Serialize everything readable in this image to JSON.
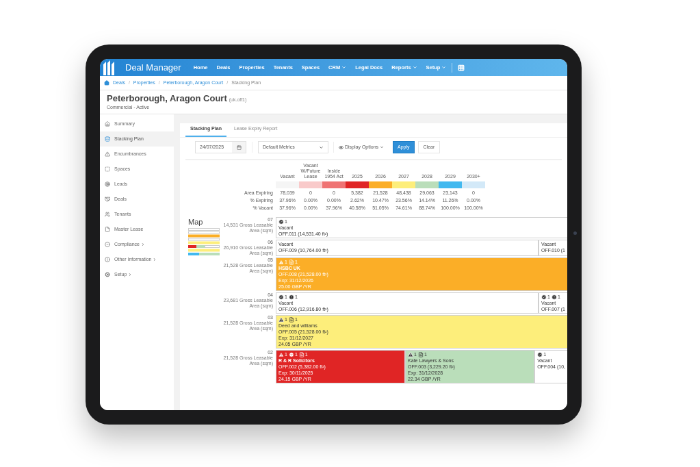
{
  "nav": {
    "brand": "Deal Manager",
    "items": [
      {
        "label": "Home",
        "dropdown": false
      },
      {
        "label": "Deals",
        "dropdown": false
      },
      {
        "label": "Properties",
        "dropdown": false
      },
      {
        "label": "Tenants",
        "dropdown": false
      },
      {
        "label": "Spaces",
        "dropdown": false
      },
      {
        "label": "CRM",
        "dropdown": true
      },
      {
        "label": "Legal Docs",
        "dropdown": false
      },
      {
        "label": "Reports",
        "dropdown": true
      },
      {
        "label": "Setup",
        "dropdown": true
      }
    ]
  },
  "breadcrumb": {
    "separator": "/",
    "items": [
      {
        "label": "Deals",
        "current": false
      },
      {
        "label": "Properties",
        "current": false
      },
      {
        "label": "Peterborough, Aragon Court",
        "current": false
      },
      {
        "label": "Stacking Plan",
        "current": true
      }
    ]
  },
  "header": {
    "title": "Peterborough, Aragon Court",
    "code": "(uk.off1)",
    "subtitle": "Commercial - Active"
  },
  "sidebar": [
    {
      "label": "Summary",
      "selected": false,
      "submenu": false
    },
    {
      "label": "Stacking Plan",
      "selected": true,
      "submenu": false
    },
    {
      "label": "Encumbrances",
      "selected": false,
      "submenu": false
    },
    {
      "label": "Spaces",
      "selected": false,
      "submenu": false
    },
    {
      "label": "Leads",
      "selected": false,
      "submenu": false
    },
    {
      "label": "Deals",
      "selected": false,
      "submenu": false
    },
    {
      "label": "Tenants",
      "selected": false,
      "submenu": false
    },
    {
      "label": "Master Lease",
      "selected": false,
      "submenu": false
    },
    {
      "label": "Compliance",
      "selected": false,
      "submenu": true
    },
    {
      "label": "Other Information",
      "selected": false,
      "submenu": true
    },
    {
      "label": "Setup",
      "selected": false,
      "submenu": true
    }
  ],
  "tabs": [
    {
      "label": "Stacking Plan",
      "selected": true
    },
    {
      "label": "Lease Expiry Report",
      "selected": false
    }
  ],
  "toolbar": {
    "date": "24/07/2025",
    "metrics": "Default Metrics",
    "display_options": "Display Options",
    "apply": "Apply",
    "clear": "Clear"
  },
  "metrics": {
    "columns": [
      {
        "label": "Vacant",
        "color": "#f5f5f5"
      },
      {
        "label": "Vacant W/Future Lease",
        "color": "#f9caca"
      },
      {
        "label": "Inside 1954 Act",
        "color": "#ef7373"
      },
      {
        "label": "2025",
        "color": "#e02525"
      },
      {
        "label": "2026",
        "color": "#fbae27"
      },
      {
        "label": "2027",
        "color": "#fdee7b"
      },
      {
        "label": "2028",
        "color": "#badeba"
      },
      {
        "label": "2029",
        "color": "#42b9ef"
      },
      {
        "label": "2030+",
        "color": "#d3e9f8"
      }
    ],
    "rows": [
      {
        "label": "Area Expiring",
        "values": [
          "78,039",
          "0",
          "0",
          "5,382",
          "21,528",
          "48,438",
          "29,063",
          "23,143",
          "0"
        ]
      },
      {
        "label": "% Expiring",
        "values": [
          "37.96%",
          "0.00%",
          "0.00%",
          "2.62%",
          "10.47%",
          "23.56%",
          "14.14%",
          "11.26%",
          "0.00%"
        ]
      },
      {
        "label": "% Vacant",
        "values": [
          "37.96%",
          "0.00%",
          "37.96%",
          "40.58%",
          "51.05%",
          "74.61%",
          "88.74%",
          "100.00%",
          "100.00%"
        ]
      }
    ]
  },
  "map_title": "Map",
  "floors": [
    {
      "number": "07",
      "area": "14,531 Gross Leasable Area (sqm)",
      "units": [
        {
          "color": "#ffffff",
          "badges": [
            {
              "kind": "check",
              "count": "1"
            }
          ],
          "lines": [
            "Vacant",
            "OFF.011 (14,531.40 ft²)"
          ]
        }
      ]
    },
    {
      "number": "06",
      "area": "26,910 Gross Leasable Area (sqm)",
      "units": [
        {
          "color": "#ffffff",
          "lines": [
            "Vacant",
            "OFF.009 (10,764.00 ft²)"
          ]
        },
        {
          "color": "#ffffff",
          "lines": [
            "Vacant",
            "OFF.010 (1"
          ]
        }
      ]
    },
    {
      "number": "05",
      "area": "21,528 Gross Leasable Area (sqm)",
      "units": [
        {
          "color": "#fbae27",
          "badges": [
            {
              "kind": "warning",
              "count": "1"
            },
            {
              "kind": "file",
              "count": "1"
            }
          ],
          "lines": [
            "HSBC UK",
            "OFF.008 (21,528.00 ft²)",
            "Exp: 31/12/2026",
            "25.00 GBP /YR"
          ]
        }
      ]
    },
    {
      "number": "04",
      "area": "23,681 Gross Leasable Area (sqm)",
      "units": [
        {
          "color": "#ffffff",
          "badges": [
            {
              "kind": "check",
              "count": "1"
            },
            {
              "kind": "info",
              "count": "1"
            }
          ],
          "lines": [
            "Vacant",
            "OFF.006 (12,916.80 ft²)"
          ]
        },
        {
          "color": "#ffffff",
          "badges": [
            {
              "kind": "check",
              "count": "1"
            },
            {
              "kind": "info",
              "count": "1"
            }
          ],
          "lines": [
            "Vacant",
            "OFF.007 (1"
          ]
        }
      ]
    },
    {
      "number": "03",
      "area": "21,528 Gross Leasable Area (sqm)",
      "units": [
        {
          "color": "#fdee7b",
          "badges": [
            {
              "kind": "warning",
              "count": "1"
            },
            {
              "kind": "file",
              "count": "1"
            }
          ],
          "lines": [
            "Deed and williams",
            "OFF.005 (21,528.00 ft²)",
            "Exp: 31/12/2027",
            "24.05 GBP /YR"
          ]
        }
      ]
    },
    {
      "number": "02",
      "area": "21,528 Gross Leasable Area (sqm)",
      "units": [
        {
          "color": "#e02525",
          "badges": [
            {
              "kind": "warning",
              "count": "1"
            },
            {
              "kind": "check",
              "count": "1"
            },
            {
              "kind": "file",
              "count": "1"
            }
          ],
          "lines": [
            "R & R Solicitors",
            "OFF.002 (5,382.00 ft²)",
            "Exp: 30/11/2025",
            "24.15 GBP /YR"
          ]
        },
        {
          "color": "#badeba",
          "badges": [
            {
              "kind": "warning",
              "count": "1"
            },
            {
              "kind": "file",
              "count": "1"
            }
          ],
          "lines": [
            "Kate Lawyers & Sons",
            "OFF.003 (3,229.20 ft²)",
            "Exp: 31/12/2028",
            "22.34 GBP /YR"
          ]
        },
        {
          "color": "#ffffff",
          "badges": [
            {
              "kind": "check",
              "count": "1"
            }
          ],
          "lines": [
            "Vacant",
            "OFF.004 (10,"
          ]
        }
      ]
    }
  ]
}
